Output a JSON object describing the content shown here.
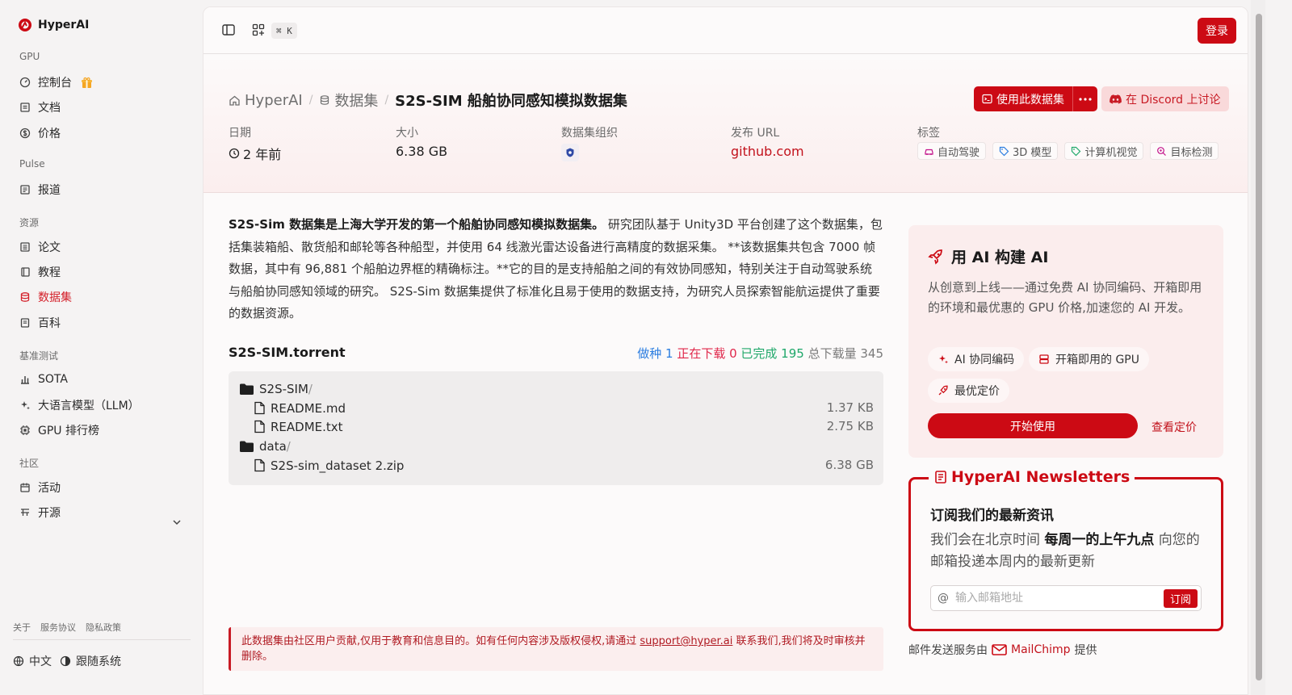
{
  "brand": {
    "name": "HyperAI",
    "color": "#cc0a14"
  },
  "sidebar": {
    "sections": [
      {
        "title": "GPU",
        "items": [
          {
            "label": "控制台",
            "icon": "gauge-icon"
          },
          {
            "label": "文档",
            "icon": "book-icon"
          },
          {
            "label": "价格",
            "icon": "dollar-icon"
          }
        ]
      },
      {
        "title": "Pulse",
        "items": [
          {
            "label": "报道",
            "icon": "newspaper-icon"
          }
        ]
      },
      {
        "title": "资源",
        "items": [
          {
            "label": "论文",
            "icon": "document-icon"
          },
          {
            "label": "教程",
            "icon": "notebook-icon"
          },
          {
            "label": "数据集",
            "icon": "database-icon",
            "active": true
          },
          {
            "label": "百科",
            "icon": "wiki-icon"
          }
        ]
      },
      {
        "title": "基准测试",
        "items": [
          {
            "label": "SOTA",
            "icon": "bar-chart-icon"
          },
          {
            "label": "大语言模型（LLM）",
            "icon": "sparkles-icon"
          },
          {
            "label": "GPU 排行榜",
            "icon": "chip-icon"
          }
        ]
      },
      {
        "title": "社区",
        "items": [
          {
            "label": "活动",
            "icon": "calendar-icon"
          },
          {
            "label": "开源",
            "icon": "source-icon"
          }
        ]
      }
    ],
    "footer_links": [
      "关于",
      "服务协议",
      "隐私政策"
    ],
    "language": "中文",
    "theme": "跟随系统"
  },
  "topbar": {
    "shortcut": "⌘ K",
    "login": "登录"
  },
  "header": {
    "breadcrumb": {
      "home": "HyperAI",
      "section": "数据集",
      "current": "S2S-SIM 船舶协同感知模拟数据集"
    },
    "use_button": "使用此数据集",
    "discord_button": "在 Discord 上讨论",
    "meta": {
      "date_label": "日期",
      "date_value": "2 年前",
      "size_label": "大小",
      "size_value": "6.38 GB",
      "org_label": "数据集组织",
      "url_label": "发布 URL",
      "url_value": "github.com",
      "tags_label": "标签"
    },
    "tags": [
      "自动驾驶",
      "3D 模型",
      "计算机视觉",
      "目标检测"
    ]
  },
  "content": {
    "desc_bold": "S2S-Sim 数据集是上海大学开发的第一个船舶协同感知模拟数据集。",
    "desc_rest": " 研究团队基于 Unity3D 平台创建了这个数据集，包括集装箱船、散货船和邮轮等各种船型，并使用 64 线激光雷达设备进行高精度的数据采集。 **该数据集共包含 7000 帧数据，其中有 96,881 个船舶边界框的精确标注。**它的目的是支持船舶之间的有效协同感知，特别关注于自动驾驶系统与船舶协同感知领域的研究。 S2S-Sim 数据集提供了标准化且易于使用的数据支持，为研究人员探索智能航运提供了重要的数据资源。",
    "torrent": {
      "name": "S2S-SIM.torrent",
      "seeds": "做种 1",
      "downloading": "正在下载 0",
      "completed": "已完成 195",
      "total": "总下载量 345",
      "files": [
        {
          "name": "S2S-SIM",
          "suffix": "/",
          "type": "folder"
        },
        {
          "name": "README.md",
          "size": "1.37 KB",
          "type": "file"
        },
        {
          "name": "README.txt",
          "size": "2.75 KB",
          "type": "file"
        },
        {
          "name": "data",
          "suffix": "/",
          "type": "folder"
        },
        {
          "name": "S2S-sim_dataset 2.zip",
          "size": "6.38 GB",
          "type": "file"
        }
      ]
    },
    "notice_pre": "此数据集由社区用户贡献,仅用于教育和信息目的。如有任何内容涉及版权侵权,请通过",
    "notice_email": "support@hyper.ai",
    "notice_post": "联系我们,我们将及时审核并删除。"
  },
  "ai_card": {
    "title": "用 AI 构建 AI",
    "desc": "从创意到上线——通过免费 AI 协同编码、开箱即用的环境和最优惠的 GPU 价格,加速您的 AI 开发。",
    "chips": [
      "AI 协同编码",
      "开箱即用的 GPU",
      "最优定价"
    ],
    "start": "开始使用",
    "pricing": "查看定价"
  },
  "newsletter": {
    "title": "HyperAI Newsletters",
    "subtitle": "订阅我们的最新资讯",
    "desc_pre": "我们会在北京时间 ",
    "desc_bold": "每周一的上午九点",
    "desc_post": " 向您的邮箱投递本周内的最新更新",
    "placeholder": "输入邮箱地址",
    "subscribe": "订阅",
    "provider_pre": "邮件发送服务由",
    "provider": "MailChimp",
    "provider_post": "提供"
  }
}
